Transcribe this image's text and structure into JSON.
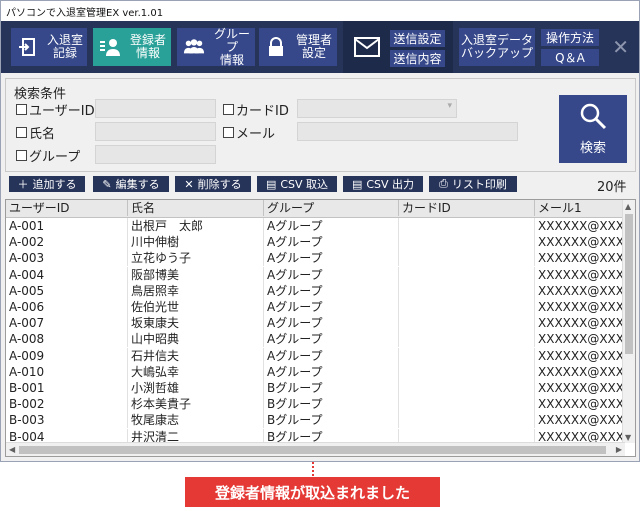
{
  "window": {
    "title": "パソコンで入退室管理EX ver.1.01"
  },
  "nav": {
    "buttons": [
      {
        "label": "入退室\n記録"
      },
      {
        "label": "登録者\n情報"
      },
      {
        "label": "グループ\n情報"
      },
      {
        "label": "管理者\n設定"
      }
    ],
    "mail": {
      "send_settings": "送信設定",
      "send_content": "送信内容"
    },
    "backup": {
      "label": "入退室データ\nバックアップ"
    },
    "help": {
      "manual": "操作方法",
      "qa": "Q＆A"
    }
  },
  "search": {
    "title": "検索条件",
    "user_id_label": "ユーザーID",
    "card_id_label": "カードID",
    "name_label": "氏名",
    "email_label": "メール",
    "group_label": "グループ",
    "button_label": "検索"
  },
  "toolbar": {
    "add": "追加する",
    "edit": "編集する",
    "delete": "削除する",
    "csv_import": "CSV 取込",
    "csv_export": "CSV 出力",
    "print": "リスト印刷"
  },
  "result_count": "20件",
  "table": {
    "headers": [
      "ユーザーID",
      "氏名",
      "グループ",
      "カードID",
      "メール1"
    ],
    "rows": [
      [
        "A-001",
        "出根戸　太郎",
        "Aグループ",
        "",
        "XXXXXX@XXX.c"
      ],
      [
        "A-002",
        "川中伸樹",
        "Aグループ",
        "",
        "XXXXXX@XXX.c"
      ],
      [
        "A-003",
        "立花ゆう子",
        "Aグループ",
        "",
        "XXXXXX@XXX.c"
      ],
      [
        "A-004",
        "阪部博美",
        "Aグループ",
        "",
        "XXXXXX@XXX.c"
      ],
      [
        "A-005",
        "鳥居照幸",
        "Aグループ",
        "",
        "XXXXXX@XXX.c"
      ],
      [
        "A-006",
        "佐伯光世",
        "Aグループ",
        "",
        "XXXXXX@XXX.c"
      ],
      [
        "A-007",
        "坂東康夫",
        "Aグループ",
        "",
        "XXXXXX@XXX.c"
      ],
      [
        "A-008",
        "山中昭典",
        "Aグループ",
        "",
        "XXXXXX@XXX.c"
      ],
      [
        "A-009",
        "石井信夫",
        "Aグループ",
        "",
        "XXXXXX@XXX.c"
      ],
      [
        "A-010",
        "大嶋弘幸",
        "Aグループ",
        "",
        "XXXXXX@XXX.c"
      ],
      [
        "B-001",
        "小渕哲雄",
        "Bグループ",
        "",
        "XXXXXX@XXX.c"
      ],
      [
        "B-002",
        "杉本美貴子",
        "Bグループ",
        "",
        "XXXXXX@XXX.c"
      ],
      [
        "B-003",
        "牧尾康志",
        "Bグループ",
        "",
        "XXXXXX@XXX.c"
      ],
      [
        "B-004",
        "井沢清二",
        "Bグループ",
        "",
        "XXXXXX@XXX.c"
      ]
    ]
  },
  "notice": "登録者情報が取込まれました",
  "colors": {
    "nav_bg": "#27345a",
    "button": "#36488a",
    "active": "#2aa198",
    "notice": "#e53935"
  }
}
